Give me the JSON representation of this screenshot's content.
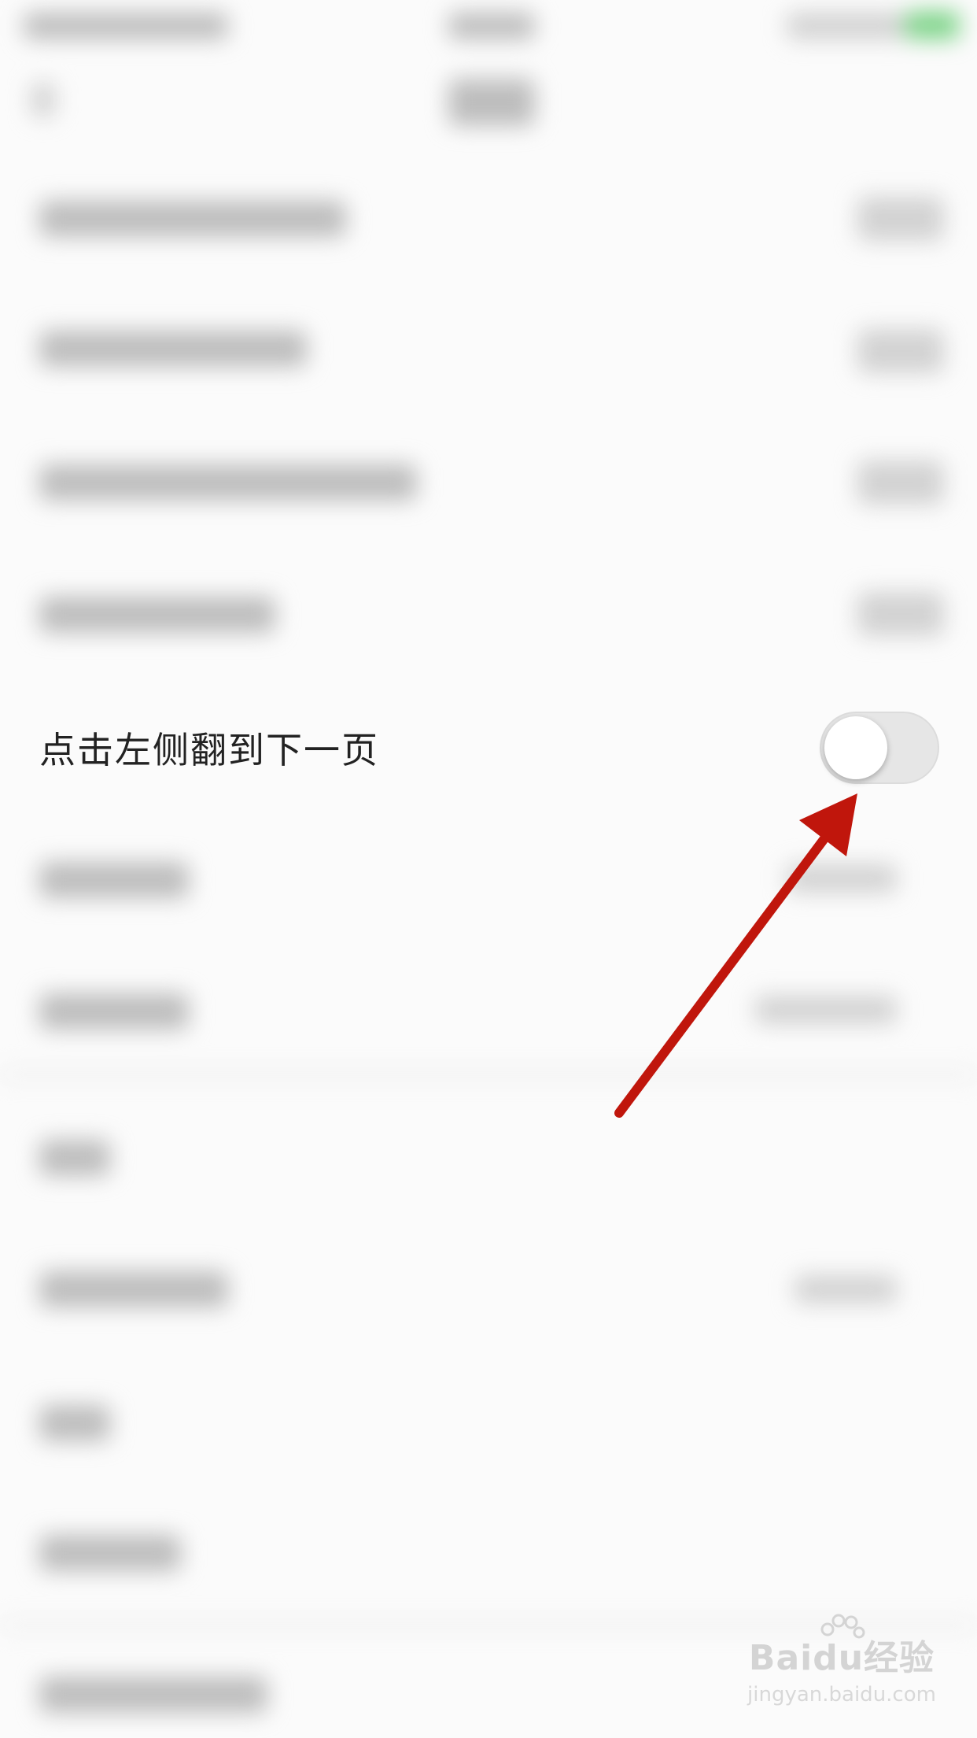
{
  "setting": {
    "label": "点击左侧翻到下一页",
    "toggle_on": false
  },
  "annotation": {
    "color": "#c0160c"
  },
  "watermark": {
    "brand": "Baidu经验",
    "url": "jingyan.baidu.com"
  }
}
